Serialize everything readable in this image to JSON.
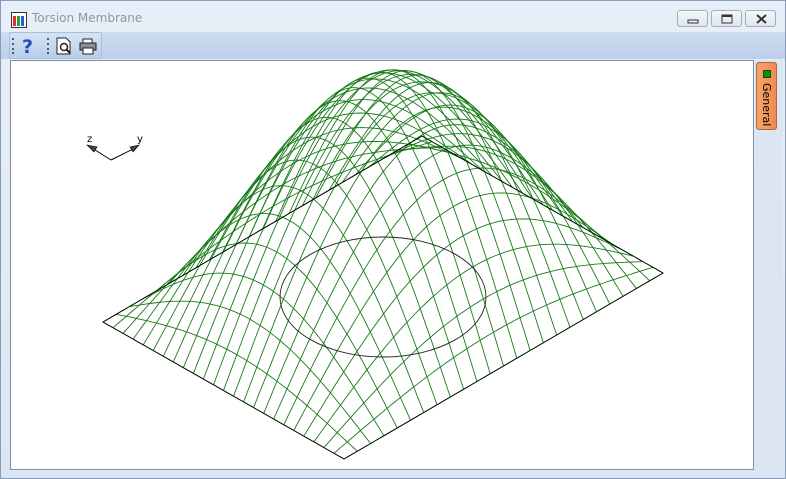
{
  "window": {
    "title": "Torsion Membrane"
  },
  "side_tabs": [
    {
      "label": "General"
    }
  ],
  "axes": {
    "z_label": "z",
    "y_label": "y"
  },
  "colors": {
    "mesh": "#1a7a1a",
    "outline": "#000000",
    "tab": "#f28a4c",
    "tab_marker": "#138a13"
  },
  "icons": {
    "help": "help-question-icon",
    "preview": "print-preview-icon",
    "print": "printer-icon"
  }
}
